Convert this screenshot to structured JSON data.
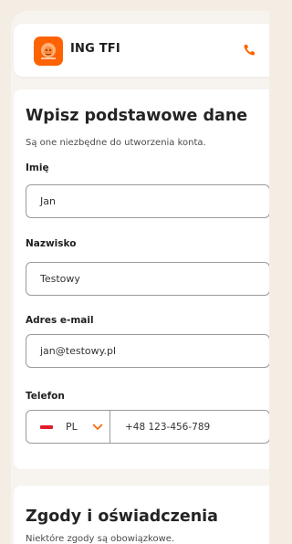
{
  "header": {
    "brand": "ING TFI",
    "logo_icon": "ing-lion-logo-icon",
    "phone_icon": "phone-icon",
    "accent_color": "#ff6200"
  },
  "form": {
    "title": "Wpisz podstawowe dane",
    "subtitle": "Są one niezbędne do utworzenia konta.",
    "first_name": {
      "label": "Imię",
      "value": "Jan"
    },
    "last_name": {
      "label": "Nazwisko",
      "value": "Testowy"
    },
    "email": {
      "label": "Adres e-mail",
      "value": "jan@testowy.pl"
    },
    "phone": {
      "label": "Telefon",
      "country_code": "PL",
      "flag_icon": "poland-flag-icon",
      "dropdown_icon": "chevron-down-icon",
      "value": "+48 123-456-789"
    }
  },
  "consents": {
    "title": "Zgody i oświadczenia",
    "subtitle": "Niektóre zgody są obowiązkowe."
  }
}
